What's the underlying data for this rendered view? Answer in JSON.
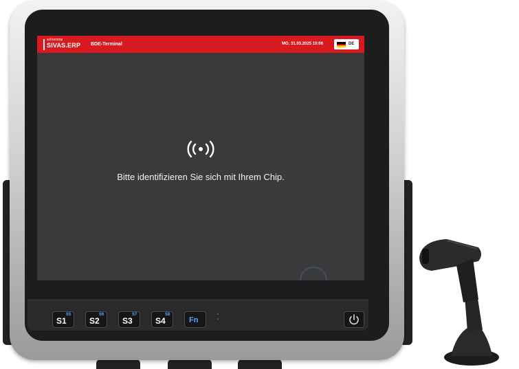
{
  "app": {
    "brand_small": "schremmp",
    "brand_name": "SIVAS.ERP",
    "title": "BDE-Terminal",
    "datetime": "MO. 31.03.2025 10:06",
    "language": "DE"
  },
  "main": {
    "prompt": "Bitte identifizieren Sie sich mit Ihrem Chip."
  },
  "keys": [
    {
      "label": "S1",
      "alt": "S5"
    },
    {
      "label": "S2",
      "alt": "S6"
    },
    {
      "label": "S3",
      "alt": "S7"
    },
    {
      "label": "S4",
      "alt": "S8"
    },
    {
      "label": "Fn"
    }
  ],
  "colors": {
    "header_red": "#d71920",
    "screen_bg": "#3a3a3a",
    "key_accent": "#5aa8ff"
  },
  "icons": [
    "nfc-icon",
    "flag-de-icon",
    "power-icon",
    "barcode-scanner"
  ]
}
